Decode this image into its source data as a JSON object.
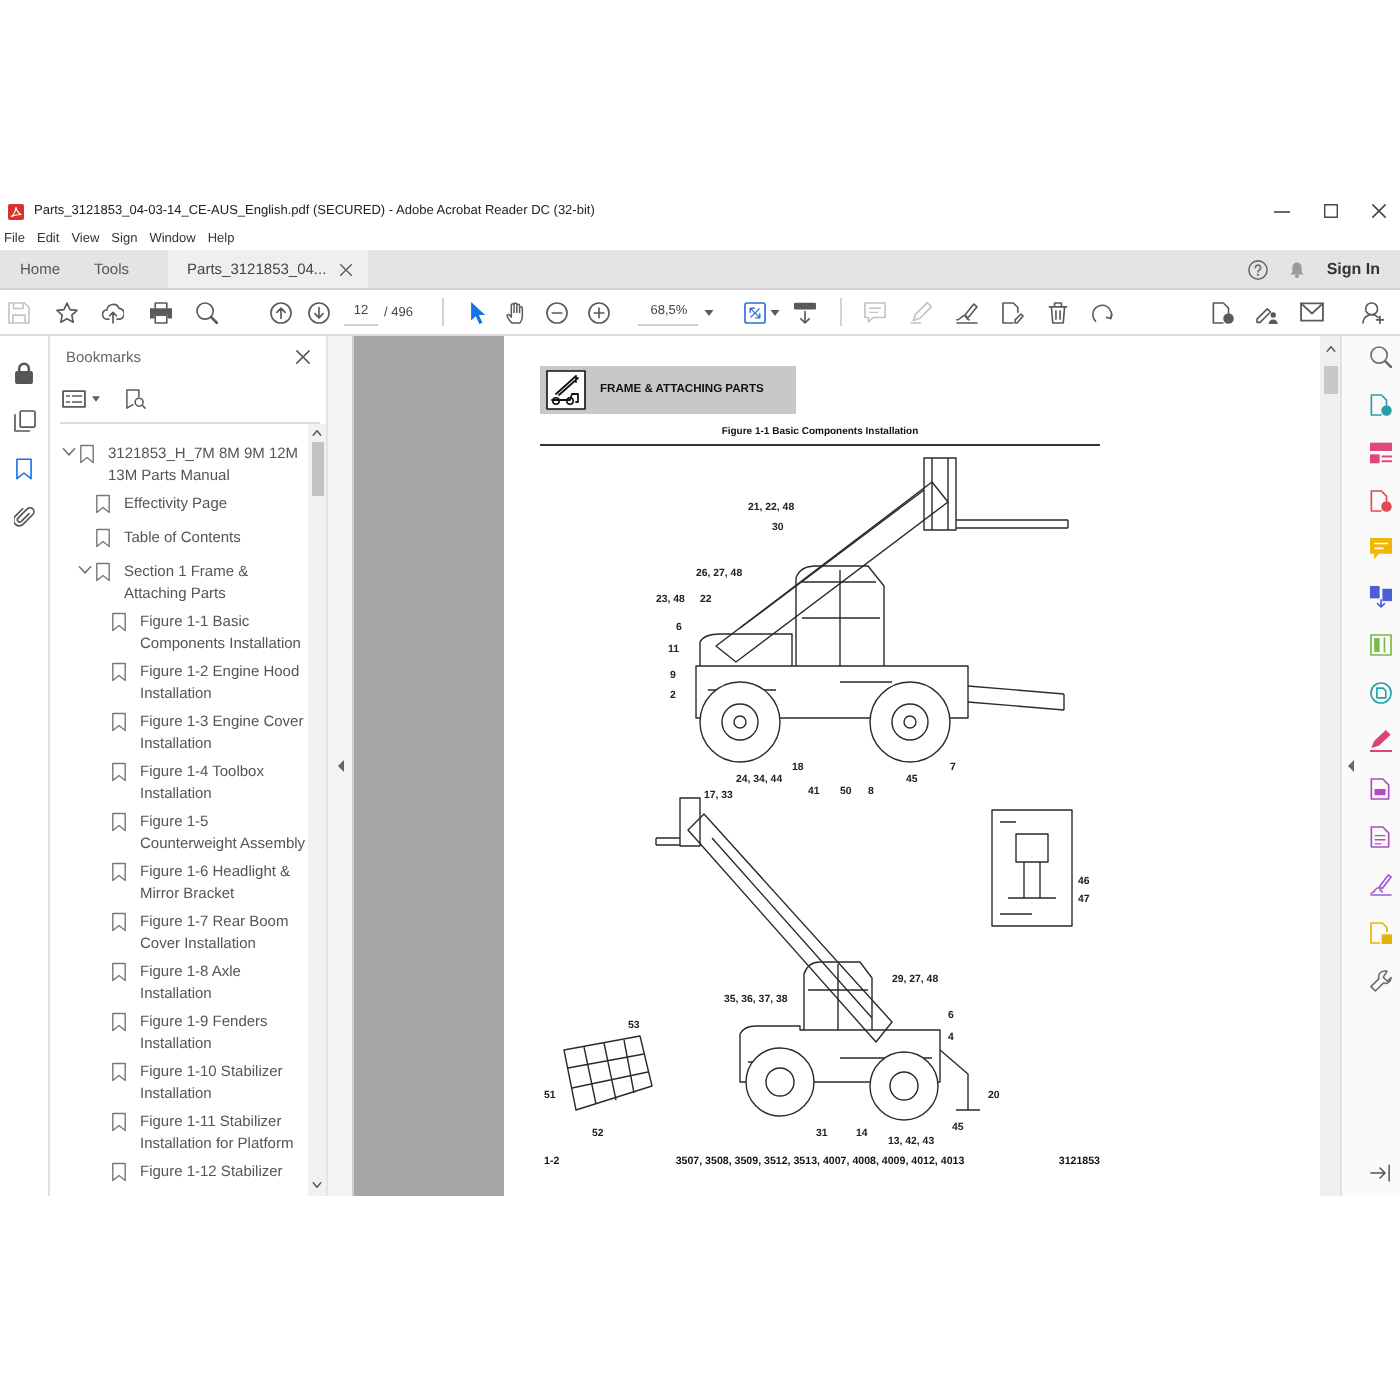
{
  "window": {
    "title": "Parts_3121853_04-03-14_CE-AUS_English.pdf (SECURED) - Adobe Acrobat Reader DC (32-bit)"
  },
  "menu": [
    "File",
    "Edit",
    "View",
    "Sign",
    "Window",
    "Help"
  ],
  "tabs": [
    {
      "label": "Home",
      "kind": "view",
      "selected": false
    },
    {
      "label": "Tools",
      "kind": "view",
      "selected": false
    },
    {
      "label": "Parts_3121853_04...",
      "kind": "document",
      "selected": true
    }
  ],
  "account": {
    "sign_in": "Sign In"
  },
  "toolbar": {
    "file_tools": [
      {
        "disabled": true
      },
      {
        "disabled": false
      },
      {
        "disabled": false
      },
      {
        "disabled": false
      },
      {
        "disabled": false
      }
    ],
    "page_field": {
      "value": "12"
    },
    "page_total": "/ 496",
    "pointer_modes": [
      {
        "selected": true
      },
      {
        "selected": false
      }
    ],
    "zoom_field": {
      "value": "68,5%"
    },
    "edit_tools": [
      {
        "disabled": true
      },
      {
        "disabled": true
      },
      {
        "disabled": false
      },
      {
        "disabled": false
      },
      {
        "disabled": false
      },
      {
        "disabled": false
      }
    ]
  },
  "nav_panel": [
    {
      "selected": false
    },
    {
      "selected": false
    },
    {
      "selected": true
    },
    {
      "selected": false
    }
  ],
  "bookmarks": {
    "title": "Bookmarks",
    "items": [
      {
        "label": "3121853_H_7M 8M 9M 12M 13M Parts Manual",
        "expanded": true,
        "children": [
          {
            "label": "Effectivity Page"
          },
          {
            "label": "Table of Contents"
          },
          {
            "label": "Section 1 Frame & Attaching Parts",
            "expanded": true,
            "children": [
              {
                "label": "Figure 1-1 Basic Components Installation"
              },
              {
                "label": "Figure 1-2 Engine Hood Installation"
              },
              {
                "label": "Figure 1-3 Engine Cover Installation"
              },
              {
                "label": "Figure 1-4 Toolbox Installation"
              },
              {
                "label": "Figure 1-5 Counterweight Assembly"
              },
              {
                "label": "Figure 1-6 Headlight & Mirror Bracket"
              },
              {
                "label": "Figure 1-7 Rear Boom Cover Installation"
              },
              {
                "label": "Figure 1-8 Axle Installation"
              },
              {
                "label": "Figure 1-9 Fenders Installation"
              },
              {
                "label": "Figure 1-10 Stabilizer Installation"
              },
              {
                "label": "Figure 1-11 Stabilizer Installation for Platform"
              },
              {
                "label": "Figure 1-12 Stabilizer"
              }
            ]
          }
        ]
      }
    ]
  },
  "document": {
    "section_title": "FRAME & ATTACHING PARTS",
    "figure_title": "Figure 1-1 Basic Components Installation",
    "callouts": [
      "21, 22, 48",
      "30",
      "26, 27, 48",
      "22",
      "23, 48",
      "6",
      "11",
      "9",
      "2",
      "24, 34, 44",
      "18",
      "17, 33",
      "41",
      "50",
      "8",
      "45",
      "7",
      "46",
      "47",
      "29, 27, 48",
      "35, 36, 37, 38",
      "6",
      "4",
      "53",
      "31",
      "14",
      "13, 42, 43",
      "45",
      "20",
      "51",
      "52"
    ],
    "footer": {
      "page": "1-2",
      "models": "3507, 3508, 3509, 3512, 3513, 4007, 4008, 4009, 4012, 4013",
      "number": "3121853"
    }
  },
  "tools_panel": [
    {
      "color": "#6e6e6e"
    },
    {
      "color": "#2c9ca6"
    },
    {
      "color": "#e0457b"
    },
    {
      "color": "#dd4a52"
    },
    {
      "color": "#f2b705"
    },
    {
      "color": "#4a5fd6"
    },
    {
      "color": "#79b84a"
    },
    {
      "color": "#23a3a6"
    },
    {
      "color": "#d9437a"
    },
    {
      "color": "#b04ac4"
    },
    {
      "color": "#a84fc2"
    },
    {
      "color": "#9b5bd0"
    },
    {
      "color": "#e3b20c"
    },
    {
      "color": "#707070"
    }
  ]
}
